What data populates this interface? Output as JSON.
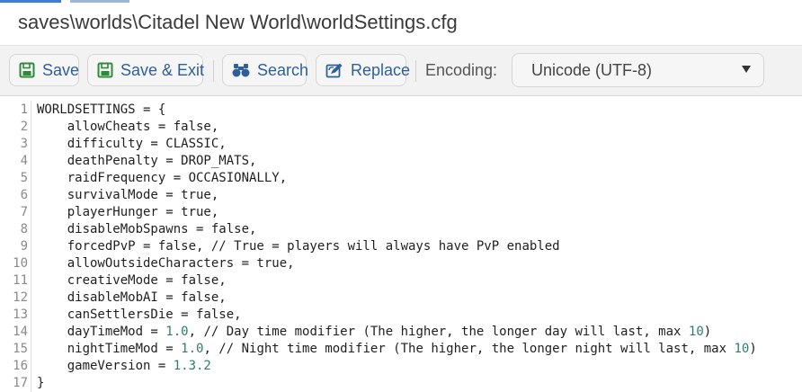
{
  "window": {
    "title": "saves\\worlds\\Citadel New World\\worldSettings.cfg"
  },
  "toolbar": {
    "save_label": "Save",
    "save_exit_label": "Save & Exit",
    "search_label": "Search",
    "replace_label": "Replace",
    "encoding_label": "Encoding:",
    "encoding_value": "Unicode (UTF-8)"
  },
  "colors": {
    "accent": "#2f5f99",
    "save_icon": "#2e8b3a",
    "number": "#2e7d6e"
  },
  "icons": {
    "save": "floppy-disk-icon",
    "save_exit": "floppy-disk-icon",
    "search": "binoculars-icon",
    "replace": "edit-replace-icon",
    "dropdown": "chevron-down-icon"
  },
  "editor": {
    "lines": [
      {
        "n": "1",
        "pre": "WORLDSETTINGS = {",
        "num": "",
        "post": ""
      },
      {
        "n": "2",
        "pre": "    allowCheats = false,",
        "num": "",
        "post": ""
      },
      {
        "n": "3",
        "pre": "    difficulty = CLASSIC,",
        "num": "",
        "post": ""
      },
      {
        "n": "4",
        "pre": "    deathPenalty = DROP_MATS,",
        "num": "",
        "post": ""
      },
      {
        "n": "5",
        "pre": "    raidFrequency = OCCASIONALLY,",
        "num": "",
        "post": ""
      },
      {
        "n": "6",
        "pre": "    survivalMode = true,",
        "num": "",
        "post": ""
      },
      {
        "n": "7",
        "pre": "    playerHunger = true,",
        "num": "",
        "post": ""
      },
      {
        "n": "8",
        "pre": "    disableMobSpawns = false,",
        "num": "",
        "post": ""
      },
      {
        "n": "9",
        "pre": "    forcedPvP = false, // True = players will always have PvP enabled",
        "num": "",
        "post": ""
      },
      {
        "n": "10",
        "pre": "    allowOutsideCharacters = true,",
        "num": "",
        "post": ""
      },
      {
        "n": "11",
        "pre": "    creativeMode = false,",
        "num": "",
        "post": ""
      },
      {
        "n": "12",
        "pre": "    disableMobAI = false,",
        "num": "",
        "post": ""
      },
      {
        "n": "13",
        "pre": "    canSettlersDie = false,",
        "num": "",
        "post": ""
      },
      {
        "n": "14",
        "pre": "    dayTimeMod = ",
        "num": "1.0",
        "post": ", // Day time modifier (The higher, the longer day will last, max ",
        "num2": "10",
        "post2": ")"
      },
      {
        "n": "15",
        "pre": "    nightTimeMod = ",
        "num": "1.0",
        "post": ", // Night time modifier (The higher, the longer night will last, max ",
        "num2": "10",
        "post2": ")"
      },
      {
        "n": "16",
        "pre": "    gameVersion = ",
        "num": "1.3.2",
        "post": ""
      },
      {
        "n": "17",
        "pre": "}",
        "num": "",
        "post": ""
      }
    ]
  }
}
